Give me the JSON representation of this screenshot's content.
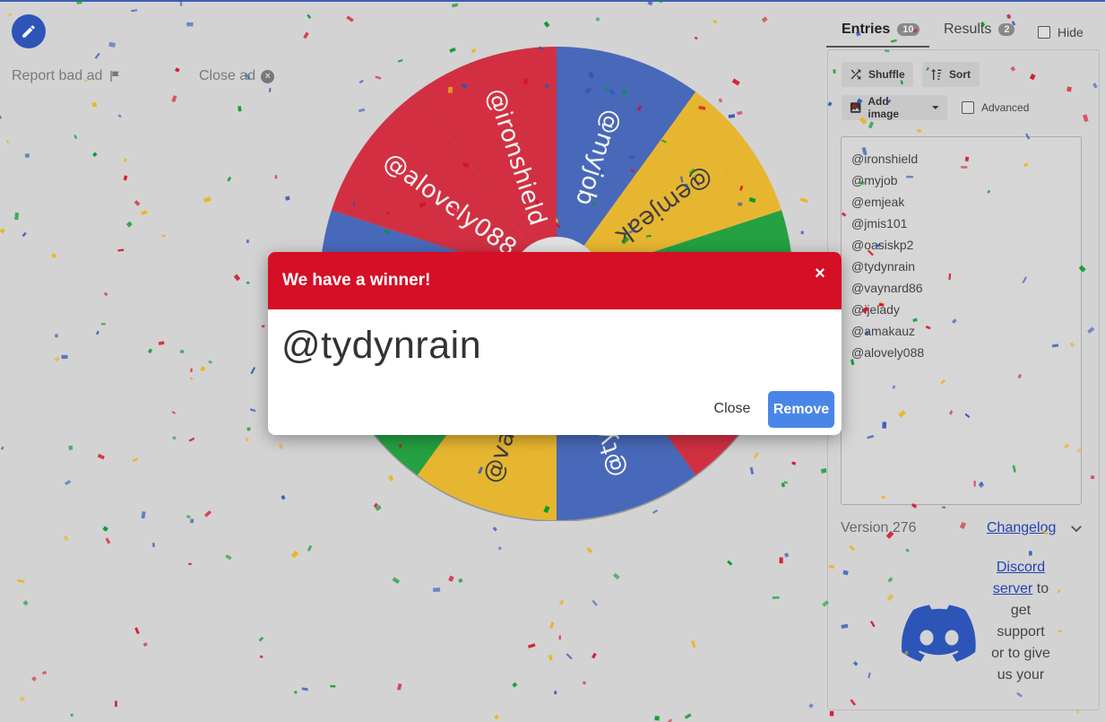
{
  "ads": {
    "report_label": "Report bad ad",
    "close_label": "Close ad"
  },
  "icons": {
    "edit": "pencil-icon",
    "report": "flag-icon",
    "close_ad": "close-circle-icon",
    "shuffle": "shuffle-icon",
    "sort": "sort-icon",
    "add_image": "image-icon",
    "dropdown": "caret-down-icon",
    "chevron": "chevron-down-icon",
    "discord": "discord-logo-icon"
  },
  "colors": {
    "red": "#d50f25",
    "blue": "#2d55b8",
    "green": "#009925",
    "yellow": "#eeb211",
    "accent_button": "#4a86e8"
  },
  "wheel": {
    "segments": [
      {
        "label": "@ironshield",
        "color": "#d50f25"
      },
      {
        "label": "@myjob",
        "color": "#2d55b8"
      },
      {
        "label": "@emjeak",
        "color": "#eeb211"
      },
      {
        "label": "@jmis101",
        "color": "#009925"
      },
      {
        "label": "@oasiskp2",
        "color": "#d50f25"
      },
      {
        "label": "@tydynrain",
        "color": "#2d55b8"
      },
      {
        "label": "@vaynard86",
        "color": "#eeb211"
      },
      {
        "label": "@ijelady",
        "color": "#009925"
      },
      {
        "label": "@amakauz",
        "color": "#2d55b8"
      },
      {
        "label": "@alovely088",
        "color": "#d50f25"
      }
    ]
  },
  "tabs": {
    "entries": {
      "label": "Entries",
      "count": "10"
    },
    "results": {
      "label": "Results",
      "count": "2"
    },
    "hide_label": "Hide"
  },
  "toolbar": {
    "shuffle": "Shuffle",
    "sort": "Sort",
    "add_image": "Add image",
    "advanced": "Advanced"
  },
  "entries": [
    "@ironshield",
    "@myjob",
    "@emjeak",
    "@jmis101",
    "@oasiskp2",
    "@tydynrain",
    "@vaynard86",
    "@ijelady",
    "@amakauz",
    "@alovely088"
  ],
  "footer": {
    "version": "Version 276",
    "changelog": "Changelog",
    "discord_link_1": "Discord",
    "discord_link_2": "server",
    "discord_text": "to get support or to give us your"
  },
  "dialog": {
    "title": "We have a winner!",
    "winner": "@tydynrain",
    "close": "Close",
    "remove": "Remove"
  }
}
